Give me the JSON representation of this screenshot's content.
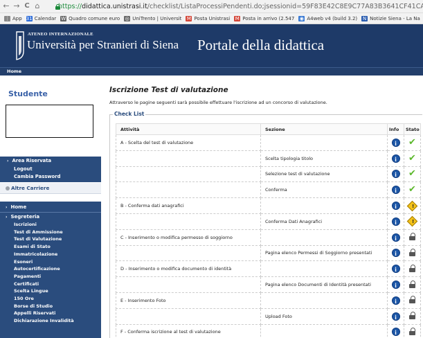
{
  "browser": {
    "back": "←",
    "forward": "→",
    "reload": "C",
    "home": "⌂",
    "url_secure": "https://",
    "url_host": "didattica.unistrasi.it",
    "url_path": "/checklist/ListaProcessiPendenti.do;jsessionid=59F83E42C8E9C77A83B3641CF41CAE62.esse",
    "bookmarks": [
      {
        "label": "App",
        "icon": "apps-grid-icon",
        "color": "#888888",
        "glyph": "⋮"
      },
      {
        "label": "Calendar",
        "icon": "calendar-icon",
        "color": "#2a6ad8",
        "glyph": "31"
      },
      {
        "label": "Quadro comune euro",
        "icon": "wikipedia-icon",
        "color": "#666666",
        "glyph": "W"
      },
      {
        "label": "UniTrento | Universit",
        "icon": "unitrento-icon",
        "color": "#6a6a6a",
        "glyph": "◎"
      },
      {
        "label": "Posta Unistrasi",
        "icon": "gmail-icon",
        "color": "#d44638",
        "glyph": "M"
      },
      {
        "label": "Posta in arrivo (2.547",
        "icon": "gmail-icon",
        "color": "#d44638",
        "glyph": "M"
      },
      {
        "label": "A4web v4 (build 3.2)",
        "icon": "a4web-icon",
        "color": "#3b7bd4",
        "glyph": "◉"
      },
      {
        "label": "Notizie Siena - La Na",
        "icon": "news-icon",
        "color": "#2a5db0",
        "glyph": "N"
      }
    ]
  },
  "header": {
    "ateneo": "ATENEO INTERNAZIONALE",
    "university": "Università per Stranieri di Siena",
    "portal": "Portale della didattica",
    "home_link": "Home"
  },
  "sidebar": {
    "title": "Studente",
    "area_riservata": "Area Riservata",
    "logout": "Logout",
    "cambia_password": "Cambia Password",
    "altre_carriere": "Altre Carriere",
    "home": "Home",
    "segreteria": "Segreteria",
    "items": [
      "Iscrizioni",
      "Test di Ammissione",
      "Test di Valutazione",
      "Esami di Stato",
      "Immatricolazione",
      "Esoneri",
      "Autocertificazione",
      "Pagamenti",
      "Certificati",
      "Scelta Lingue",
      "150 Ore",
      "Borse di Studio",
      "Appelli Riservati",
      "Dichiarazione Invalidità"
    ]
  },
  "main": {
    "title": "Iscrizione Test di valutazione",
    "intro": "Attraverso le pagine seguenti sarà possibile effettuare l'iscrizione ad un concorso di valutazione.",
    "legend": "Check List",
    "columns": [
      "Attività",
      "Sezione",
      "Info",
      "Stato"
    ],
    "rows": [
      {
        "attivita": "A - Scelta del test di valutazione",
        "sezione": "",
        "stato": "done"
      },
      {
        "attivita": "",
        "sezione": "Scelta tipologia titolo",
        "stato": "done"
      },
      {
        "attivita": "",
        "sezione": "Selezione test di valutazione",
        "stato": "done"
      },
      {
        "attivita": "",
        "sezione": "Conferma",
        "stato": "done"
      },
      {
        "attivita": "B - Conferma dati anagrafici",
        "sezione": "",
        "stato": "warning"
      },
      {
        "attivita": "",
        "sezione": "Conferma Dati Anagrafici",
        "stato": "warning"
      },
      {
        "attivita": "C - Inserimento o modifica permesso di soggiorno",
        "sezione": "",
        "stato": "locked"
      },
      {
        "attivita": "",
        "sezione": "Pagina elenco Permessi di Soggiorno presentati",
        "stato": "locked"
      },
      {
        "attivita": "D - Inserimento o modifica documento di identità",
        "sezione": "",
        "stato": "locked"
      },
      {
        "attivita": "",
        "sezione": "Pagina elenco Documenti di Identità presentati",
        "stato": "locked"
      },
      {
        "attivita": "E - Inserimento Foto",
        "sezione": "",
        "stato": "locked"
      },
      {
        "attivita": "",
        "sezione": "Upload Foto",
        "stato": "locked"
      },
      {
        "attivita": "F - Conferma iscrizione al test di valutazione",
        "sezione": "",
        "stato": "locked"
      }
    ]
  },
  "colors": {
    "header_bg": "#1e3a68",
    "sidebar_bg": "#2a4c7d",
    "title_blue": "#3a62a8",
    "check_green": "#5cb82c",
    "warning_yellow": "#f3c21a"
  }
}
